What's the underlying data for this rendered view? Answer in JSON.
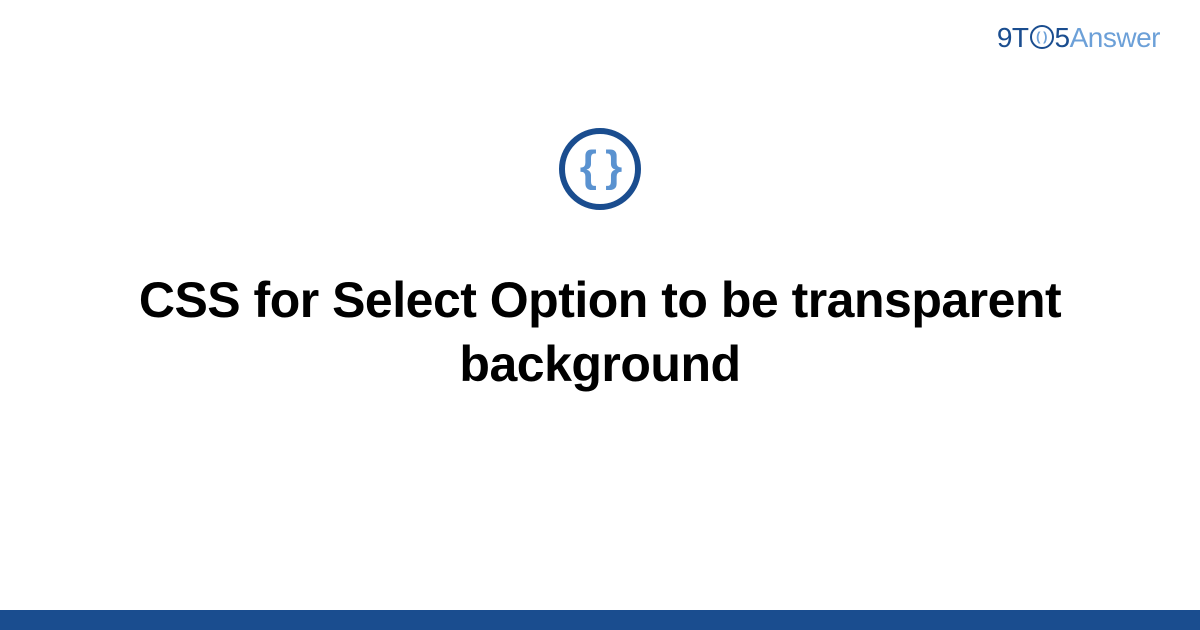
{
  "logo": {
    "part1": "9T",
    "part2_inner": "( )",
    "part3": "5",
    "part4": "Answer"
  },
  "icon": {
    "braces": "{ }"
  },
  "title": "CSS for Select Option to be transparent background",
  "colors": {
    "dark_blue": "#1a4d8f",
    "light_blue": "#6ca0d8",
    "brace_blue": "#5a92d0"
  }
}
